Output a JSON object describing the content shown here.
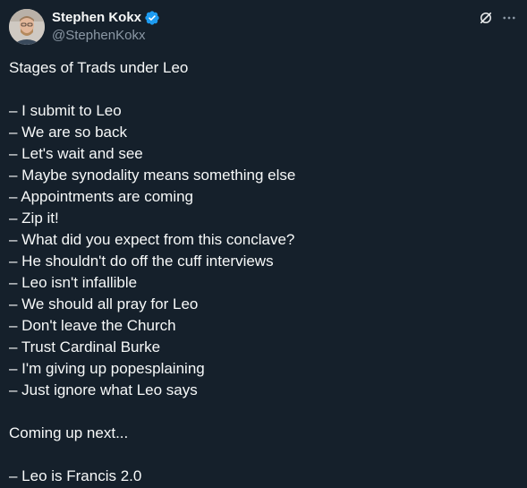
{
  "author": {
    "display_name": "Stephen Kokx",
    "handle": "@StephenKokx",
    "verified": true,
    "verified_color": "#1d9bf0",
    "avatar_icon": "profile-photo-icon"
  },
  "header_actions": {
    "grok_icon": "grok-icon",
    "more_icon": "more-horizontal-icon"
  },
  "tweet": {
    "text": "Stages of Trads under Leo\n\n– I submit to Leo\n– We are so back\n– Let's wait and see\n– Maybe synodality means something else\n– Appointments are coming\n– Zip it!\n– What did you expect from this conclave?\n– He shouldn't do off the cuff interviews\n– Leo isn't infallible\n– We should all pray for Leo\n– Don't leave the Church\n– Trust Cardinal Burke\n– I'm giving up popesplaining\n– Just ignore what Leo says\n\nComing up next...\n\n– Leo is Francis 2.0"
  },
  "colors": {
    "background": "#15202b",
    "primary_text": "#f7f9f9",
    "secondary_text": "#8b98a5"
  }
}
